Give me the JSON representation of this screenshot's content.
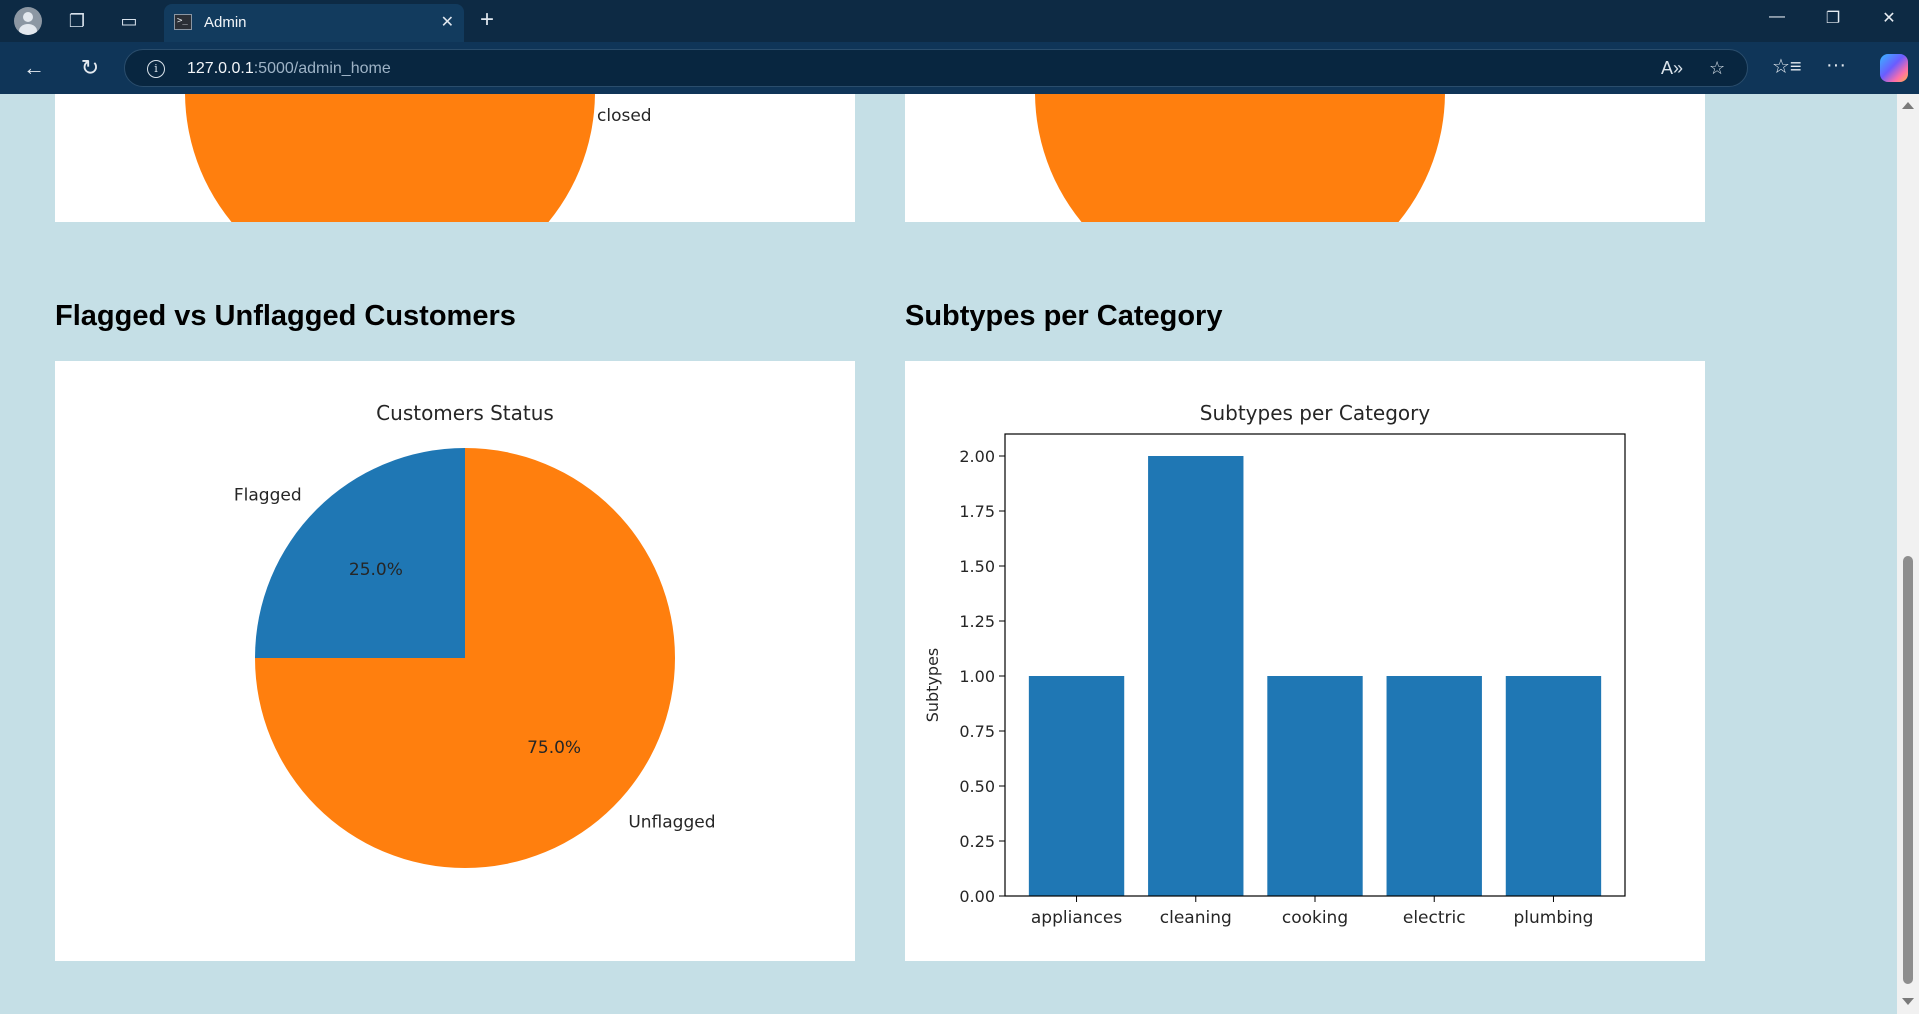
{
  "browser": {
    "tab_title": "Admin",
    "url_host": "127.0.0.1",
    "url_path": ":5000/admin_home"
  },
  "page": {
    "top_left_partial_label": "closed",
    "sections": [
      {
        "title": "Flagged vs Unflagged Customers"
      },
      {
        "title": "Subtypes per Category"
      }
    ]
  },
  "chart_data": [
    {
      "type": "pie",
      "title": "Customers Status",
      "labels": [
        "Flagged",
        "Unflagged"
      ],
      "values": [
        25.0,
        75.0
      ],
      "autopct": [
        "25.0%",
        "75.0%"
      ],
      "colors": [
        "#1f77b4",
        "#ff7f0e"
      ]
    },
    {
      "type": "bar",
      "title": "Subtypes per Category",
      "categories": [
        "appliances",
        "cleaning",
        "cooking",
        "electric",
        "plumbing"
      ],
      "values": [
        1,
        2,
        1,
        1,
        1
      ],
      "xlabel": "",
      "ylabel": "Subtypes",
      "ylim": [
        0,
        2.1
      ],
      "yticks": [
        "0.00",
        "0.25",
        "0.50",
        "0.75",
        "1.00",
        "1.25",
        "1.50",
        "1.75",
        "2.00"
      ],
      "color": "#1f77b4",
      "grid": false
    }
  ]
}
